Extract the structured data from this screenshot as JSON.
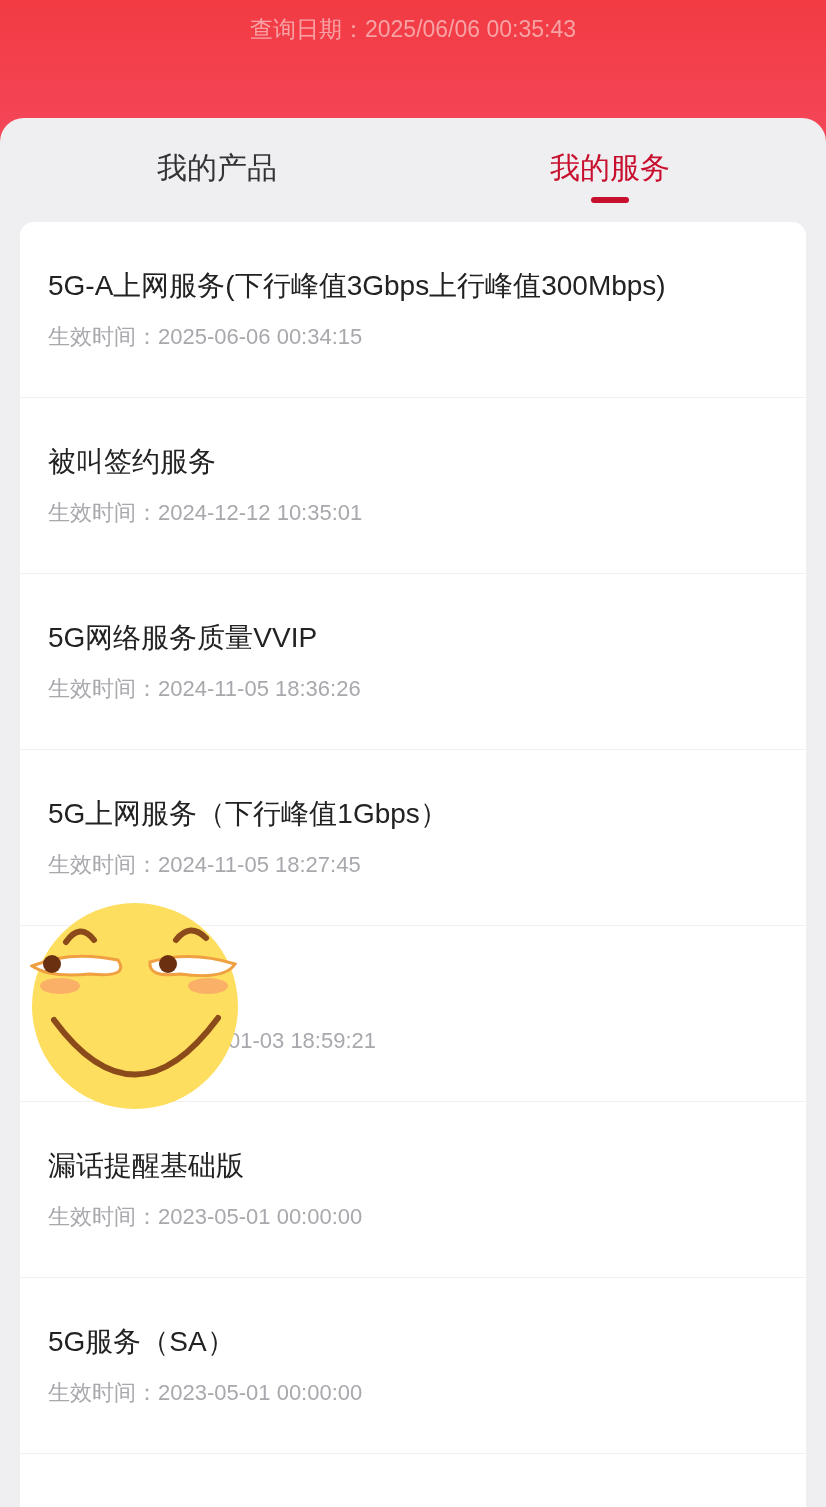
{
  "header": {
    "query_date": "查询日期：2025/06/06 00:35:43"
  },
  "tabs": [
    {
      "label": "我的产品",
      "selected": false
    },
    {
      "label": "我的服务",
      "selected": true
    }
  ],
  "services": [
    {
      "kind": "full",
      "title": "5G-A上网服务(下行峰值3Gbps上行峰值300Mbps)",
      "date": "生效时间：2025-06-06 00:34:15"
    },
    {
      "kind": "full",
      "title": "被叫签约服务",
      "date": "生效时间：2024-12-12 10:35:01"
    },
    {
      "kind": "full",
      "title": "5G网络服务质量VVIP",
      "date": "生效时间：2024-11-05 18:36:26"
    },
    {
      "kind": "full",
      "title": "5G上网服务（下行峰值1Gbps）",
      "date": "生效时间：2024-11-05 18:27:45"
    },
    {
      "kind": "covered",
      "date": "01-03 18:59:21"
    },
    {
      "kind": "full",
      "title": "漏话提醒基础版",
      "date": "生效时间：2023-05-01 00:00:00"
    },
    {
      "kind": "full",
      "title": "5G服务（SA）",
      "date": "生效时间：2023-05-01 00:00:00"
    }
  ],
  "sticker": {
    "kind": "smiley"
  }
}
